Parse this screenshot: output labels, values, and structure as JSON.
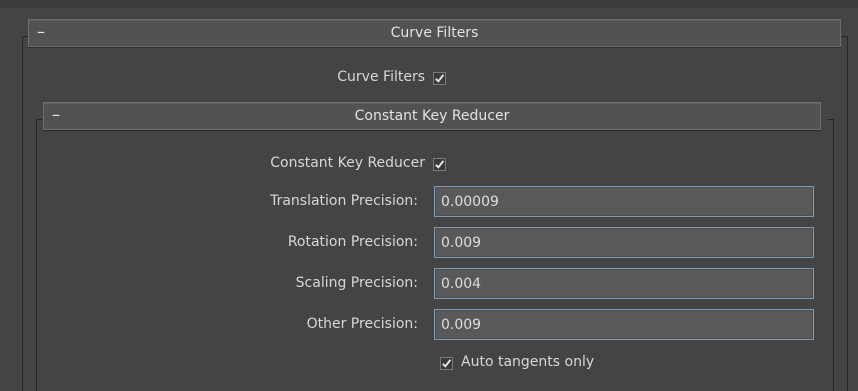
{
  "curve_filters_rollout": {
    "toggle": "–",
    "title": "Curve Filters",
    "checkbox_label": "Curve Filters",
    "checked": true
  },
  "constant_key_reducer_rollout": {
    "toggle": "–",
    "title": "Constant Key Reducer",
    "checkbox_label": "Constant Key Reducer",
    "checked": true,
    "fields": [
      {
        "label": "Translation Precision:",
        "value": "0.00009"
      },
      {
        "label": "Rotation Precision:",
        "value": "0.009"
      },
      {
        "label": "Scaling Precision:",
        "value": "0.004"
      },
      {
        "label": "Other Precision:",
        "value": "0.009"
      }
    ],
    "auto_tangents": {
      "label": "Auto tangents only",
      "checked": true
    }
  },
  "icons": {
    "checkmark": "checkmark-icon",
    "collapse": "collapse-minus-icon"
  },
  "colors": {
    "background": "#444444",
    "header": "#525252",
    "field_border": "#7e9bb8",
    "text": "#dcdcdc"
  }
}
